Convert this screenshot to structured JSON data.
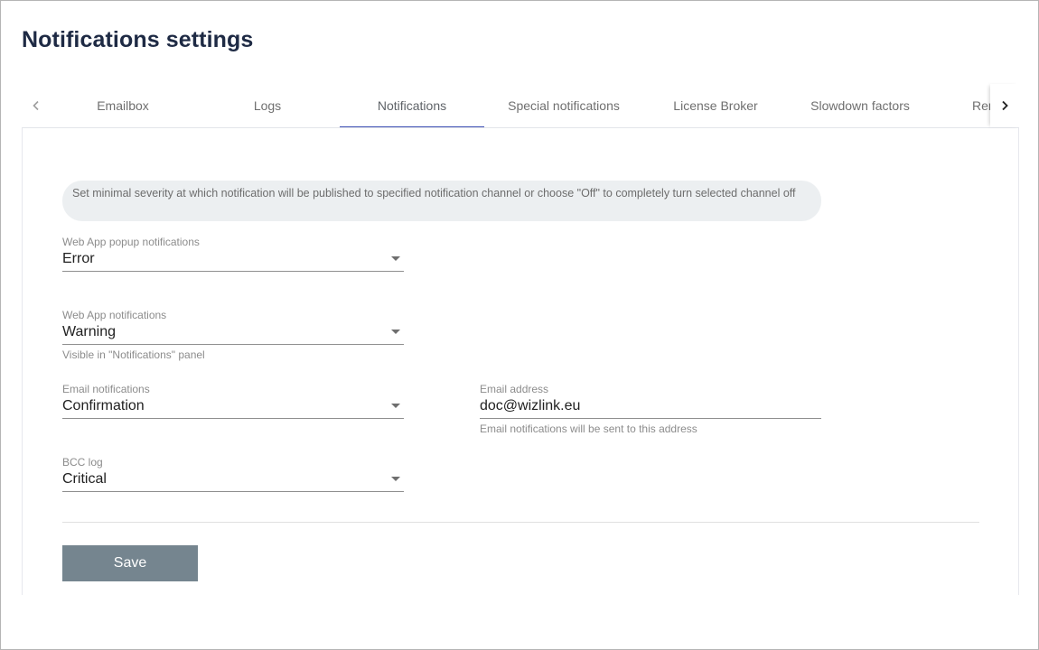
{
  "page": {
    "title": "Notifications settings"
  },
  "tabs": {
    "prev_icon": "chevron-left-icon",
    "next_icon": "chevron-right-icon",
    "items": [
      {
        "label": "Emailbox",
        "active": false
      },
      {
        "label": "Logs",
        "active": false
      },
      {
        "label": "Notifications",
        "active": true
      },
      {
        "label": "Special notifications",
        "active": false
      },
      {
        "label": "License Broker",
        "active": false
      },
      {
        "label": "Slowdown factors",
        "active": false
      },
      {
        "label": "Remo",
        "active": false
      }
    ]
  },
  "info": {
    "text": "Set minimal severity at which notification will be published to specified notification channel or choose \"Off\" to completely turn selected channel off"
  },
  "form": {
    "web_app_popup": {
      "label": "Web App popup notifications",
      "value": "Error"
    },
    "web_app": {
      "label": "Web App notifications",
      "value": "Warning",
      "hint": "Visible in \"Notifications\" panel"
    },
    "email_notifications": {
      "label": "Email notifications",
      "value": "Confirmation"
    },
    "email_address": {
      "label": "Email address",
      "value": "doc@wizlink.eu",
      "hint": "Email notifications will be sent to this address"
    },
    "bcc_log": {
      "label": "BCC log",
      "value": "Critical"
    }
  },
  "actions": {
    "save_label": "Save"
  },
  "colors": {
    "accent": "#3f51b5",
    "save_button": "#75858f",
    "title": "#1e2a44",
    "info_bg": "#eceff1"
  }
}
